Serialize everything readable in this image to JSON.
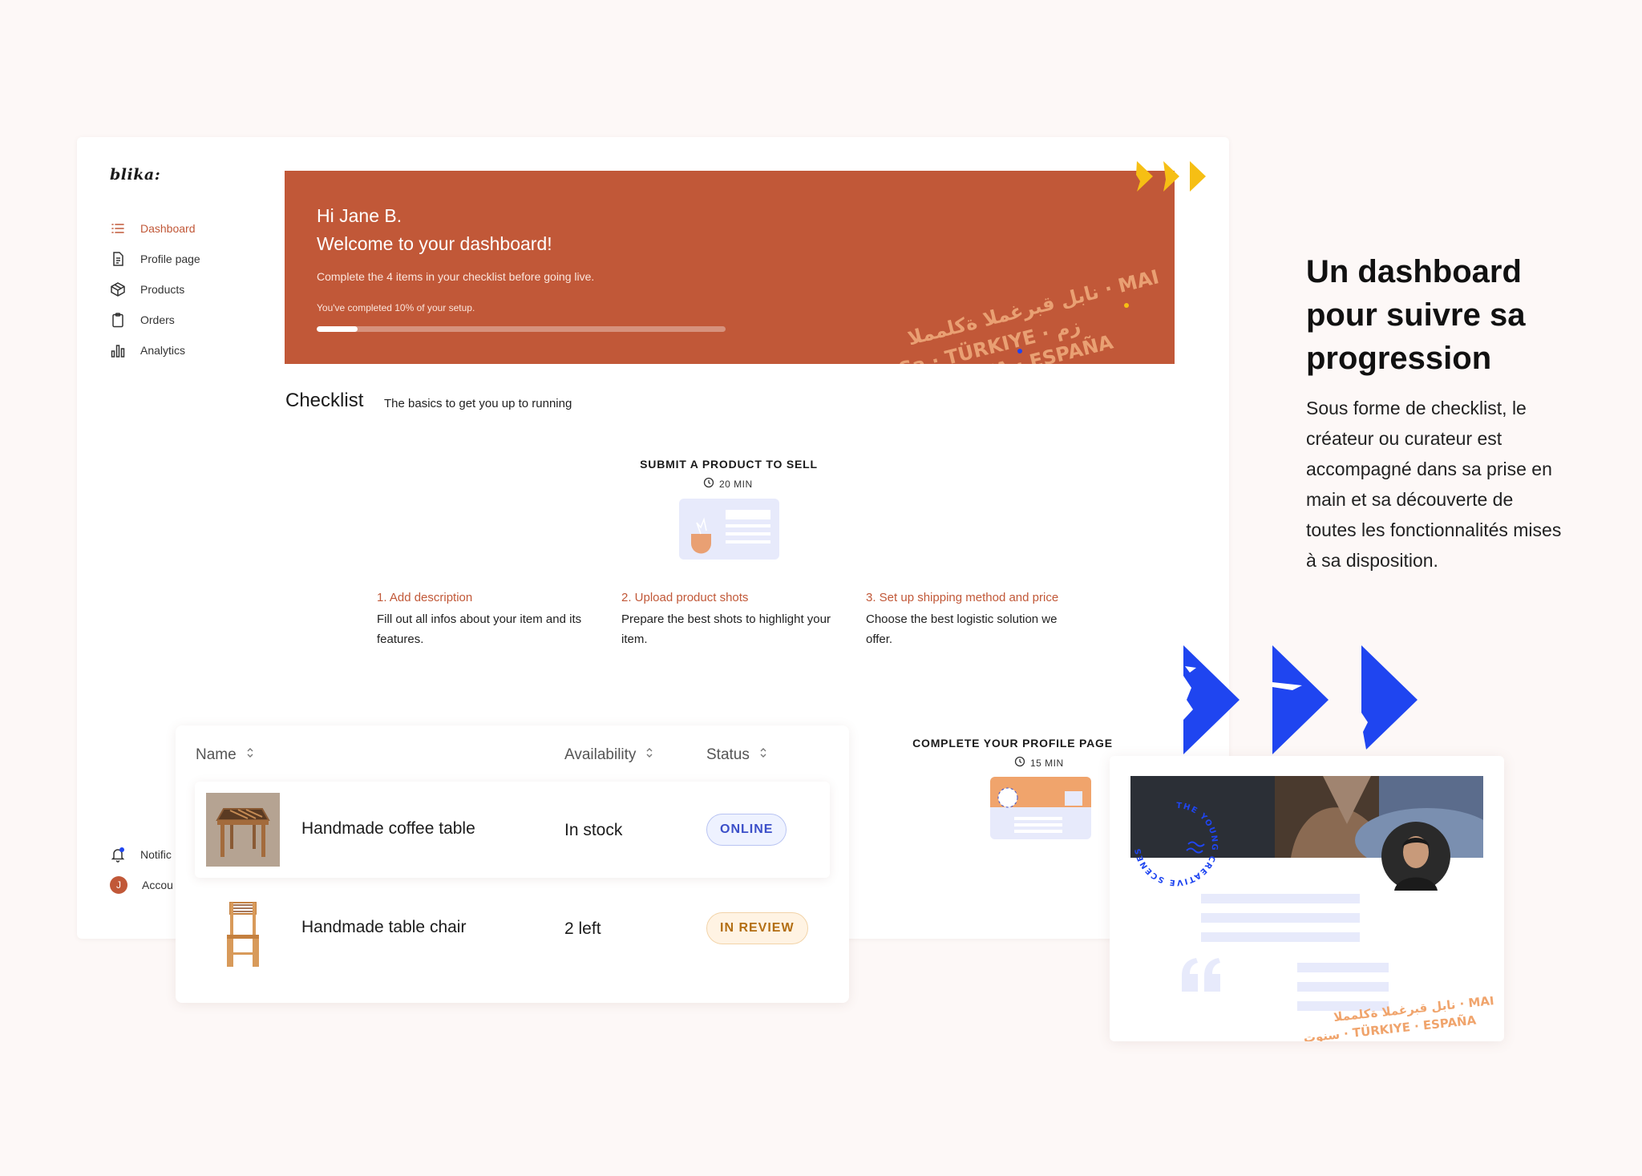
{
  "app": {
    "logo": "blika:"
  },
  "sidebar": {
    "items": [
      {
        "label": "Dashboard",
        "icon": "list-icon",
        "active": true
      },
      {
        "label": "Profile page",
        "icon": "document-icon"
      },
      {
        "label": "Products",
        "icon": "box-icon"
      },
      {
        "label": "Orders",
        "icon": "clipboard-icon"
      },
      {
        "label": "Analytics",
        "icon": "bar-chart-icon"
      }
    ],
    "bottom": [
      {
        "label": "Notific",
        "icon": "bell-icon"
      },
      {
        "label": "Accou",
        "icon": "avatar-icon",
        "avatar_letter": "J"
      }
    ]
  },
  "banner": {
    "greeting": "Hi Jane B.",
    "welcome": "Welcome to your dashboard!",
    "subtitle": "Complete the 4 items in your checklist before going live.",
    "progress_text": "You've completed 10% of your setup.",
    "progress_value": 0.1
  },
  "checklist": {
    "title": "Checklist",
    "subtitle": "The basics to get you up to running",
    "task1": {
      "title": "SUBMIT A PRODUCT TO SELL",
      "time": "20 MIN"
    },
    "steps": [
      {
        "title": "1. Add description",
        "desc": "Fill out all infos about your item and its features."
      },
      {
        "title": "2. Upload product shots",
        "desc": "Prepare the best shots to highlight your item."
      },
      {
        "title": "3. Set up shipping method and price",
        "desc": "Choose the best logistic solution we offer."
      }
    ],
    "task2": {
      "title": "COMPLETE YOUR PROFILE PAGE",
      "time": "15 MIN"
    }
  },
  "products_table": {
    "columns": [
      "Name",
      "Availability",
      "Status"
    ],
    "rows": [
      {
        "name": "Handmade coffee table",
        "availability": "In stock",
        "status": "ONLINE"
      },
      {
        "name": "Handmade table chair",
        "availability": "2 left",
        "status": "IN REVIEW"
      }
    ]
  },
  "hero": {
    "title": "Un dashboard pour suivre sa progression",
    "body": "Sous forme de checklist, le créateur ou curateur est accompagné dans sa prise en main et sa découverte de toutes les fonctionnalités mises à sa disposition."
  },
  "colors": {
    "accent": "#c15838",
    "background": "#fdf8f7",
    "brand_blue": "#1f45f0",
    "brand_yellow": "#f6bf14",
    "online": "#3b4fc9",
    "review": "#b36e12"
  }
}
